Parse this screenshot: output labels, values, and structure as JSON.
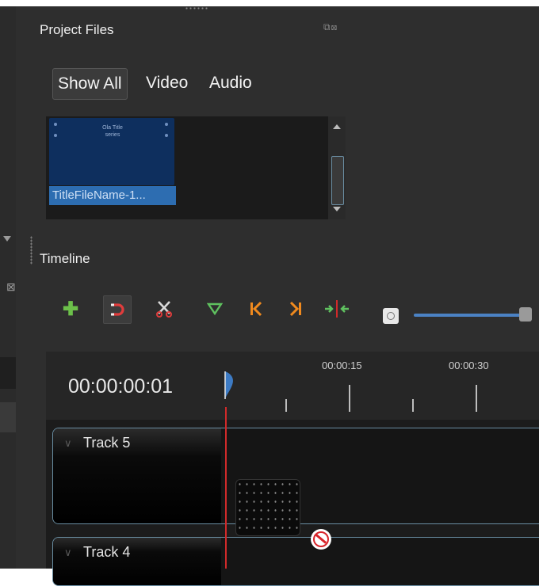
{
  "project_files": {
    "title": "Project Files",
    "filters": [
      "Show All",
      "Video",
      "Audio"
    ],
    "active_filter": "Show All",
    "files": [
      {
        "name": "TitleFileName-1...",
        "thumb_text": "Ola Title\nseries",
        "selected": true
      }
    ]
  },
  "timeline": {
    "title": "Timeline",
    "current_time": "00:00:00:01",
    "ruler_labels": [
      "00:00:15",
      "00:00:30"
    ],
    "tracks": [
      {
        "name": "Track 5"
      },
      {
        "name": "Track 4"
      }
    ],
    "toolbar": {
      "icons": [
        "add-track-icon",
        "snap-icon",
        "razor-icon",
        "add-marker-icon",
        "previous-marker-icon",
        "next-marker-icon",
        "center-playhead-icon",
        "zoom-icon"
      ]
    },
    "zoom_level": 0.95
  },
  "colors": {
    "accent": "#2d6db1",
    "playhead": "#d12a2a",
    "add": "#6cc04a",
    "snap": "#e03c3c",
    "marker_nav": "#f08a1e",
    "marker": "#5fc15f"
  }
}
